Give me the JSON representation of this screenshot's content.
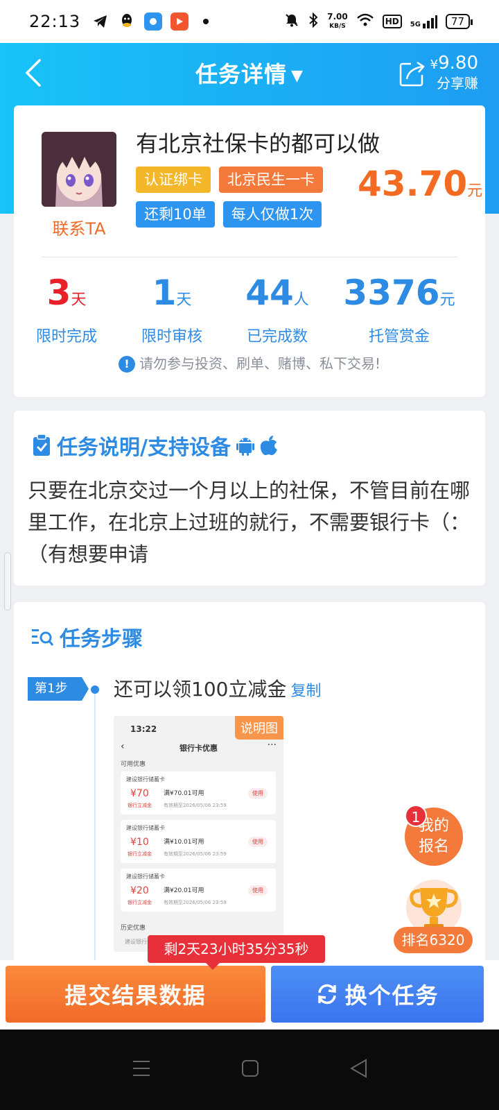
{
  "status_bar": {
    "time": "22:13",
    "net_speed": "7.00",
    "net_unit": "KB/S",
    "hd": "HD",
    "signal": "5G",
    "battery": "77"
  },
  "nav": {
    "title": "任务详情",
    "share_yen": "¥",
    "share_amount": "9.80",
    "share_label": "分享赚"
  },
  "task": {
    "contact_label": "联系TA",
    "title": "有北京社保卡的都可以做",
    "tags": [
      "认证绑卡",
      "北京民生一卡",
      "还剩10单",
      "每人仅做1次"
    ],
    "price": "43.70",
    "price_unit": "元",
    "stats": [
      {
        "value": "3",
        "unit": "天",
        "label": "限时完成",
        "color": "#e8202a"
      },
      {
        "value": "1",
        "unit": "天",
        "label": "限时审核",
        "color": "#2d8be3"
      },
      {
        "value": "44",
        "unit": "人",
        "label": "已完成数",
        "color": "#2d8be3"
      },
      {
        "value": "3376",
        "unit": "元",
        "label": "托管赏金",
        "color": "#2d8be3"
      }
    ],
    "warning": "请勿参与投资、刷单、赌博、私下交易!"
  },
  "description": {
    "title": "任务说明/支持设备",
    "text": "只要在北京交过一个月以上的社保，不管目前在哪里工作，在北京上过班的就行，不需要银行卡（：（有想要申请"
  },
  "steps": {
    "title": "任务步骤",
    "step1_badge": "第1步",
    "step1_text": "还可以领100立减金",
    "copy_label": "复制",
    "screenshot": {
      "badge": "说明图",
      "time": "13:22",
      "header": "银行卡优惠",
      "available_label": "可用优惠",
      "history_label": "历史优惠",
      "history_item": "建设银行指定储蓄卡",
      "coupons": [
        {
          "bank": "建设银行储蓄卡",
          "amount": "¥70",
          "type": "银行立减金",
          "condition": "满¥70.01可用",
          "expiry": "有效期至2026/05/06 23:59",
          "action": "使用"
        },
        {
          "bank": "建设银行储蓄卡",
          "amount": "¥10",
          "type": "银行立减金",
          "condition": "满¥10.01可用",
          "expiry": "有效期至2026/05/06 23:59",
          "action": "使用"
        },
        {
          "bank": "建设银行储蓄卡",
          "amount": "¥20",
          "type": "银行立减金",
          "condition": "满¥20.01可用",
          "expiry": "有效期至2026/05/06 23:59",
          "action": "使用"
        }
      ]
    }
  },
  "float": {
    "signup_badge": "1",
    "signup_line1": "我的",
    "signup_line2": "报名",
    "rank": "排名6320"
  },
  "bottom": {
    "countdown": "剩2天23小时35分35秒",
    "submit_label": "提交结果数据",
    "swap_label": "换个任务"
  },
  "colors": {
    "accent": "#2d8be3",
    "orange": "#f36b22",
    "red": "#e8202a"
  }
}
